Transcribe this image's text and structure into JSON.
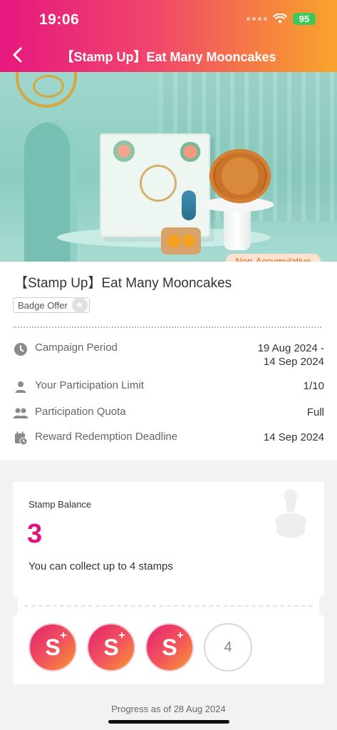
{
  "status_bar": {
    "time": "19:06",
    "battery": "95"
  },
  "nav": {
    "title": "【Stamp Up】Eat Many Mooncakes"
  },
  "hero": {
    "tag": "Non-Accumulative"
  },
  "campaign": {
    "title": "【Stamp Up】Eat Many Mooncakes",
    "badge": "Badge Offer",
    "details": [
      {
        "icon": "clock-icon",
        "label": "Campaign Period",
        "value_line1": "19 Aug 2024 -",
        "value_line2": "14 Sep 2024"
      },
      {
        "icon": "person-icon",
        "label": "Your Participation Limit",
        "value": "1/10"
      },
      {
        "icon": "people-icon",
        "label": "Participation Quota",
        "value": "Full"
      },
      {
        "icon": "calendar-clock-icon",
        "label": "Reward Redemption Deadline",
        "value": "14 Sep 2024"
      }
    ]
  },
  "stamp_card": {
    "label": "Stamp Balance",
    "balance": "3",
    "note": "You can collect up to 4 stamps",
    "collected": 3,
    "total": 4,
    "empty_slot_label": "4"
  },
  "footer": {
    "progress_note": "Progress as of 28 Aug 2024"
  },
  "colors": {
    "brand_pink": "#e4127c",
    "brand_orange": "#f8a42a",
    "tag_text": "#e0631a"
  }
}
